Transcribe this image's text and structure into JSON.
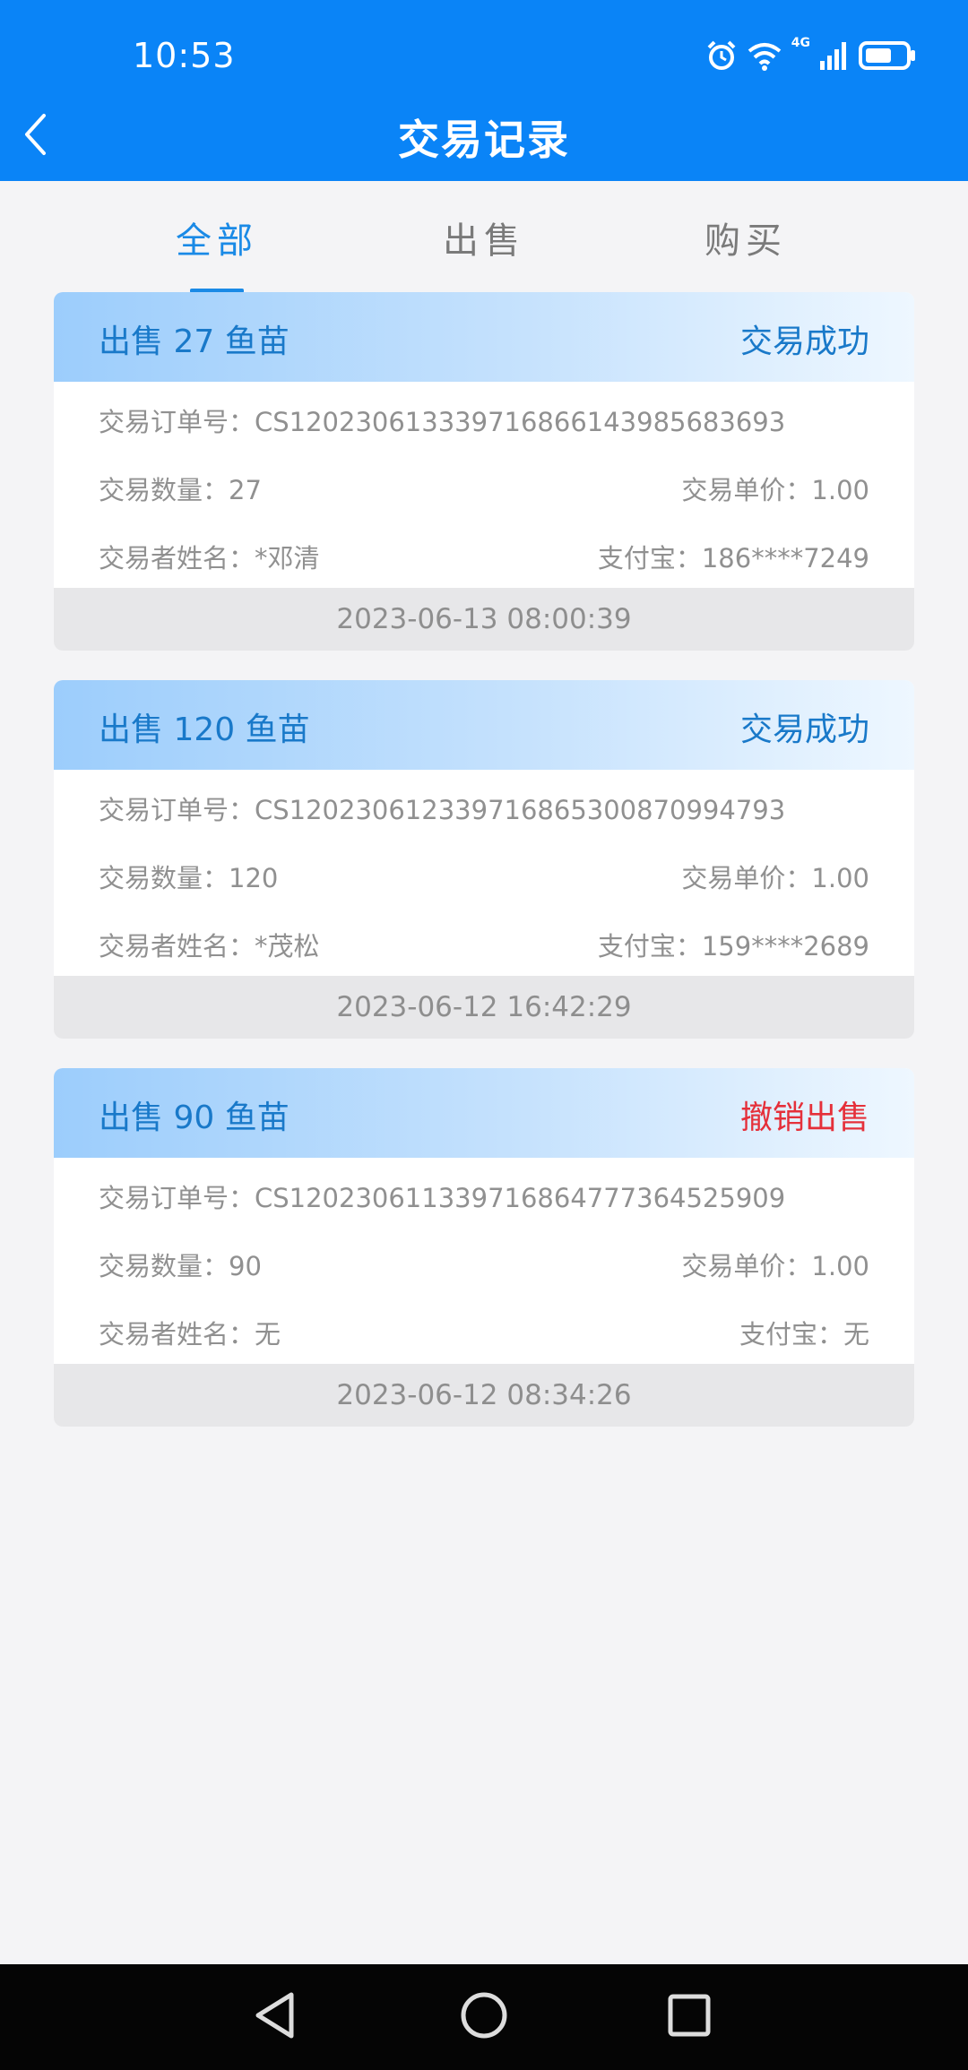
{
  "status_bar": {
    "time": "10:53",
    "network_label": "4G",
    "icons": [
      "alarm-icon",
      "wifi-icon",
      "signal-icon",
      "battery-icon"
    ]
  },
  "nav": {
    "title": "交易记录",
    "back_icon": "chevron-left-icon"
  },
  "tabs": [
    {
      "label": "全部",
      "active": true
    },
    {
      "label": "出售",
      "active": false
    },
    {
      "label": "购买",
      "active": false
    }
  ],
  "records": [
    {
      "title": "出售 27 鱼苗",
      "status": "交易成功",
      "status_type": "success",
      "order_no": "交易订单号：CS120230613339716866143985683693",
      "quantity": "交易数量：27",
      "unit_price": "交易单价：1.00",
      "trader_name": "交易者姓名：*邓清",
      "alipay": "支付宝：186****7249",
      "time": "2023-06-13 08:00:39"
    },
    {
      "title": "出售 120 鱼苗",
      "status": "交易成功",
      "status_type": "success",
      "order_no": "交易订单号：CS120230612339716865300870994793",
      "quantity": "交易数量：120",
      "unit_price": "交易单价：1.00",
      "trader_name": "交易者姓名：*茂松",
      "alipay": "支付宝：159****2689",
      "time": "2023-06-12 16:42:29"
    },
    {
      "title": "出售 90 鱼苗",
      "status": "撤销出售",
      "status_type": "cancelled",
      "order_no": "交易订单号：CS120230611339716864777364525909",
      "quantity": "交易数量：90",
      "unit_price": "交易单价：1.00",
      "trader_name": "交易者姓名：无",
      "alipay": "支付宝：无",
      "time": "2023-06-12 08:34:26"
    }
  ],
  "colors": {
    "header": "#0a84f7",
    "accent": "#1a8ae6",
    "success": "#1979c9",
    "cancelled": "#e5303a",
    "background": "#f4f4f6"
  },
  "system_nav": [
    "back-triangle-icon",
    "home-circle-icon",
    "recents-square-icon"
  ]
}
